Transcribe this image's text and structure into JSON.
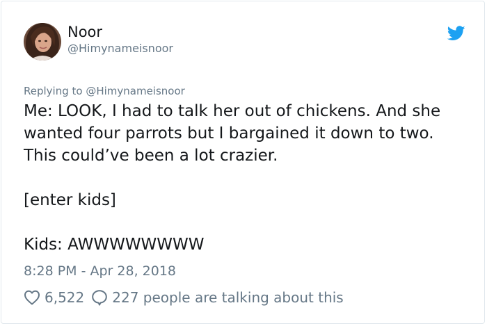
{
  "author": {
    "name": "Noor",
    "handle": "@Himynameisnoor"
  },
  "reply_context": "Replying to @Himynameisnoor",
  "tweet_lines": [
    "Me: LOOK, I had to talk her out of chickens. And she",
    "wanted four parrots but I bargained it down to two.",
    "This could’ve been a lot crazier.",
    "",
    "[enter kids]",
    "",
    "Kids: AWWWWWWWW"
  ],
  "timestamp": "8:28 PM - Apr 28, 2018",
  "stats": {
    "likes": "6,522",
    "talking": "227 people are talking about this"
  },
  "icons": {
    "logo": "twitter-bird-icon",
    "like": "heart-icon",
    "reply": "speech-bubble-icon"
  },
  "colors": {
    "brand": "#1da1f2",
    "text": "#14171a",
    "secondary": "#657786",
    "border": "#e1e8ed"
  }
}
